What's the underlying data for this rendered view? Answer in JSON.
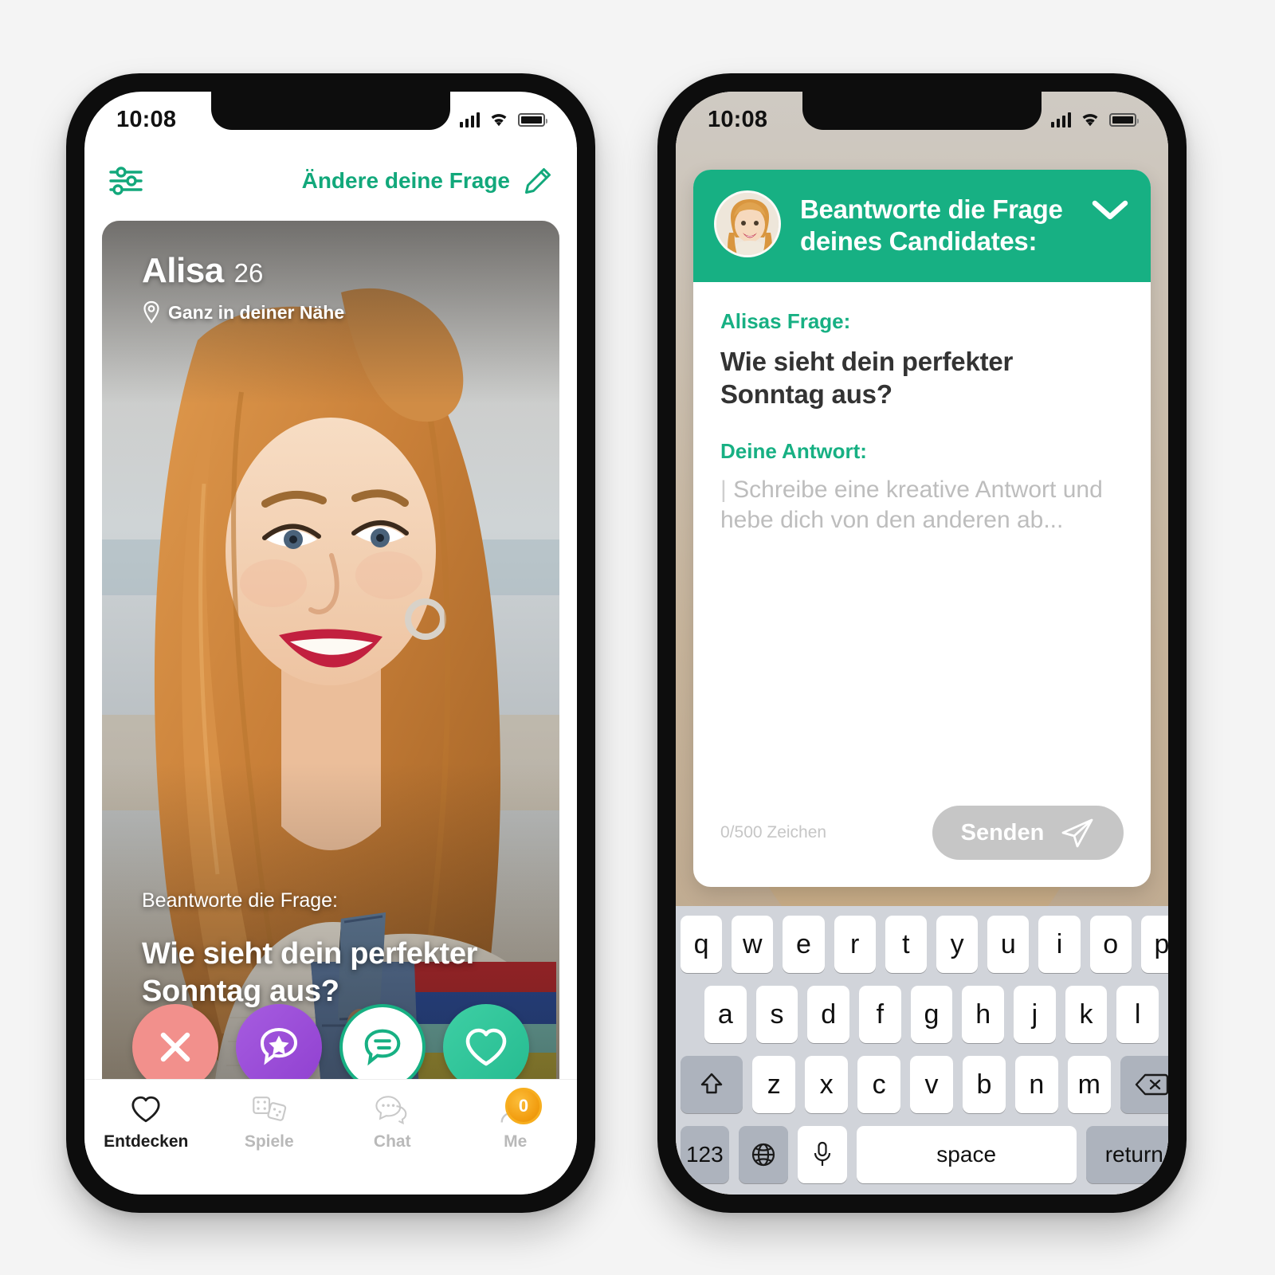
{
  "background_color": "#f4f4f4",
  "brand": {
    "green": "#17b083",
    "nope_pink": "#f2908c",
    "star_purple": "#9b4edb",
    "like_green": "#2fc49a",
    "coin_orange": "#f5a623"
  },
  "left_phone": {
    "status_bar": {
      "time": "10:08",
      "signal_icon": "cellular-bars-icon",
      "wifi_icon": "wifi-icon",
      "battery_icon": "battery-icon"
    },
    "topbar": {
      "filter_icon": "sliders-filter-icon",
      "change_question_label": "Ändere deine Frage",
      "edit_icon": "pencil-icon"
    },
    "card": {
      "name": "Alisa",
      "age": "26",
      "location_icon": "location-pin-icon",
      "location": "Ganz in deiner Nähe",
      "question_label": "Beantworte die Frage:",
      "question": "Wie sieht dein perfekter Sonntag aus?"
    },
    "actions": [
      {
        "name": "nope-button",
        "icon": "close-x-icon"
      },
      {
        "name": "superlike-button",
        "icon": "star-chat-bubble-icon"
      },
      {
        "name": "message-button",
        "icon": "chat-bubble-icon"
      },
      {
        "name": "like-button",
        "icon": "heart-icon"
      }
    ],
    "tabbar": [
      {
        "label": "Entdecken",
        "icon": "heart-icon",
        "active": true
      },
      {
        "label": "Spiele",
        "icon": "dice-icon",
        "active": false
      },
      {
        "label": "Chat",
        "icon": "chat-bubbles-icon",
        "active": false
      },
      {
        "label": "Me",
        "icon": "person-icon",
        "active": false,
        "badge": "0"
      }
    ]
  },
  "right_phone": {
    "status_bar": {
      "time": "10:08",
      "signal_icon": "cellular-bars-icon",
      "wifi_icon": "wifi-icon",
      "battery_icon": "battery-icon"
    },
    "sheet": {
      "avatar_icon": "profile-avatar",
      "header_title": "Beantworte die Frage deines Candidates:",
      "collapse_icon": "chevron-down-icon",
      "question_label": "Alisas Frage:",
      "question": "Wie sieht dein perfekter Sonntag aus?",
      "answer_label": "Deine Antwort:",
      "answer_value": "",
      "answer_placeholder": "Schreibe eine kreative Antwort und hebe dich von den anderen ab...",
      "counter": "0/500 Zeichen",
      "send_label": "Senden",
      "send_icon": "paper-plane-icon"
    },
    "keyboard": {
      "row1": [
        "q",
        "w",
        "e",
        "r",
        "t",
        "y",
        "u",
        "i",
        "o",
        "p"
      ],
      "row2": [
        "a",
        "s",
        "d",
        "f",
        "g",
        "h",
        "j",
        "k",
        "l"
      ],
      "row3": [
        "z",
        "x",
        "c",
        "v",
        "b",
        "n",
        "m"
      ],
      "shift_icon": "shift-arrow-icon",
      "backspace_icon": "backspace-icon",
      "numbers_label": "123",
      "globe_icon": "globe-icon",
      "mic_icon": "microphone-icon",
      "space_label": "space",
      "return_label": "return"
    }
  }
}
